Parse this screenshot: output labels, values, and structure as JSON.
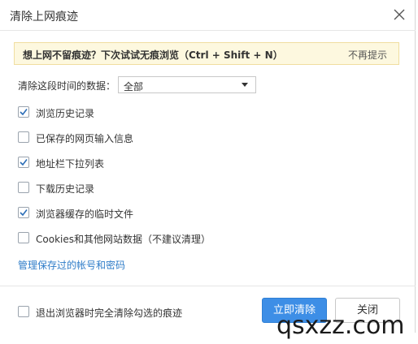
{
  "dialog": {
    "title": "清除上网痕迹",
    "notice": {
      "text": "想上网不留痕迹？下次试试无痕浏览（Ctrl + Shift + N）",
      "dismiss": "不再提示"
    },
    "range": {
      "label": "清除这段时间的数据：",
      "selected": "全部"
    },
    "options": [
      {
        "label": "浏览历史记录",
        "checked": true
      },
      {
        "label": "已保存的网页输入信息",
        "checked": false
      },
      {
        "label": "地址栏下拉列表",
        "checked": true
      },
      {
        "label": "下载历史记录",
        "checked": false
      },
      {
        "label": "浏览器缓存的临时文件",
        "checked": true
      },
      {
        "label": "Cookies和其他网站数据（不建议清理）",
        "checked": false
      }
    ],
    "manage_link": "管理保存过的帐号和密码",
    "footer": {
      "exit_clear_label": "退出浏览器时完全清除勾选的痕迹",
      "exit_clear_checked": false,
      "clear_button": "立即清除",
      "close_button": "关闭"
    }
  },
  "watermark": "qsxzz.com",
  "colors": {
    "primary": "#3d8ee6",
    "link": "#2e7cc8",
    "notice_bg": "#fdf8df",
    "check": "#2d6fb7"
  }
}
